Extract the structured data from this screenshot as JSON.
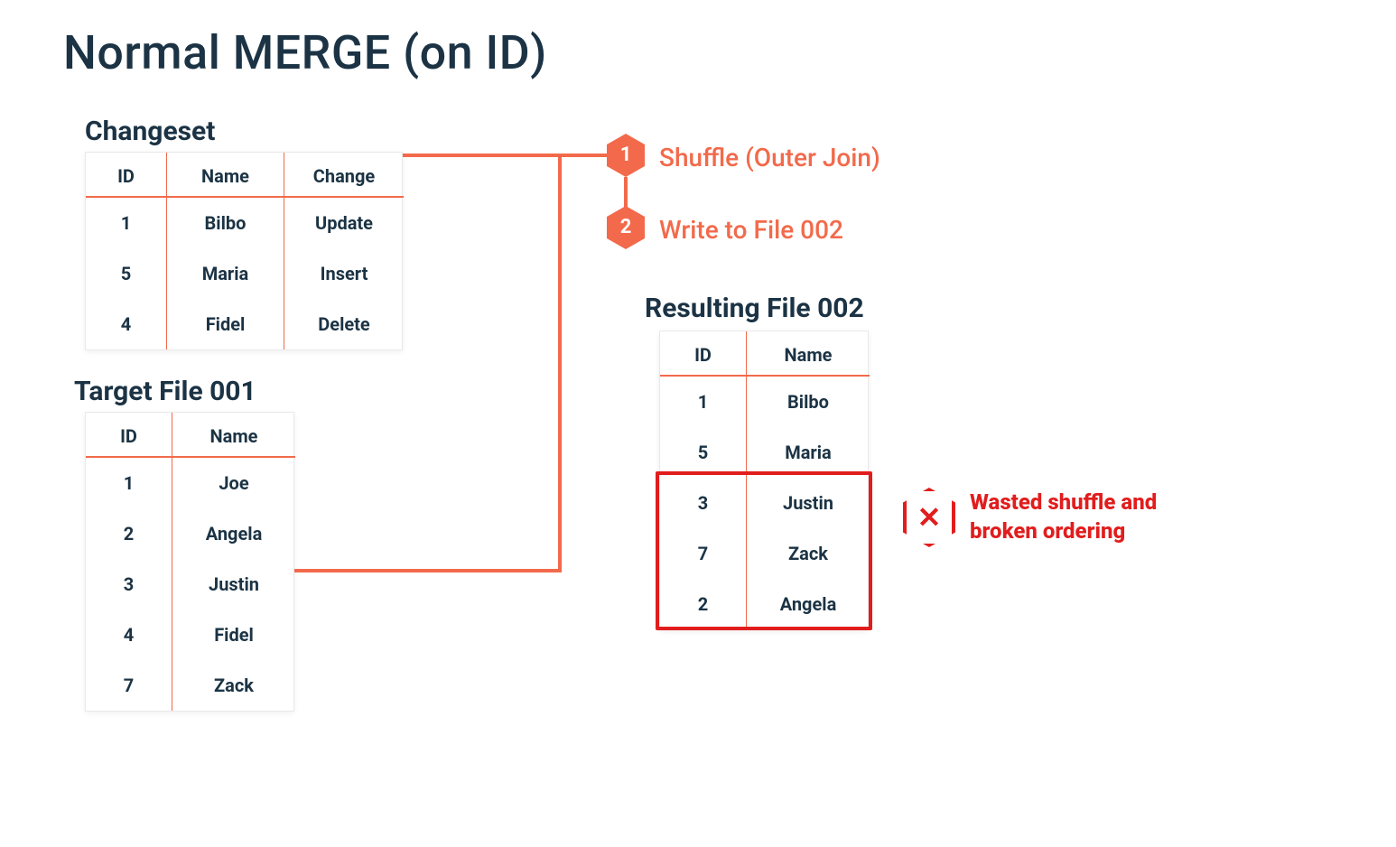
{
  "title": "Normal MERGE (on ID)",
  "colors": {
    "accent": "#f26a4b",
    "error": "#e11d1d",
    "text": "#1b3344"
  },
  "changeset": {
    "label": "Changeset",
    "columns": [
      "ID",
      "Name",
      "Change"
    ],
    "rows": [
      {
        "id": "1",
        "name": "Bilbo",
        "change": "Update"
      },
      {
        "id": "5",
        "name": "Maria",
        "change": "Insert"
      },
      {
        "id": "4",
        "name": "Fidel",
        "change": "Delete"
      }
    ]
  },
  "target": {
    "label": "Target File 001",
    "columns": [
      "ID",
      "Name"
    ],
    "rows": [
      {
        "id": "1",
        "name": "Joe"
      },
      {
        "id": "2",
        "name": "Angela"
      },
      {
        "id": "3",
        "name": "Justin"
      },
      {
        "id": "4",
        "name": "Fidel"
      },
      {
        "id": "7",
        "name": "Zack"
      }
    ]
  },
  "result": {
    "label": "Resulting File 002",
    "columns": [
      "ID",
      "Name"
    ],
    "rows": [
      {
        "id": "1",
        "name": "Bilbo"
      },
      {
        "id": "5",
        "name": "Maria"
      },
      {
        "id": "3",
        "name": "Justin"
      },
      {
        "id": "7",
        "name": "Zack"
      },
      {
        "id": "2",
        "name": "Angela"
      }
    ]
  },
  "steps": [
    {
      "num": "1",
      "label": "Shuffle (Outer Join)"
    },
    {
      "num": "2",
      "label": "Write to File 002"
    }
  ],
  "error": {
    "text": "Wasted shuffle and broken ordering",
    "icon": "x-icon"
  }
}
